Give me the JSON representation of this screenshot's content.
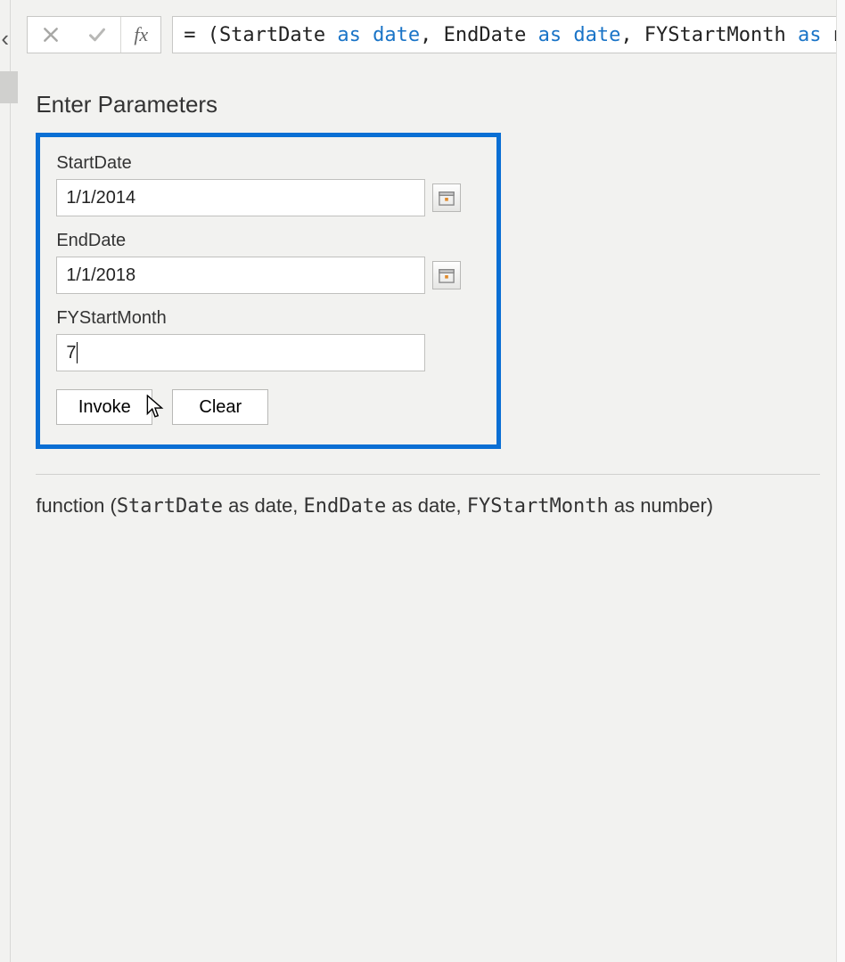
{
  "formula_bar": {
    "prefix": "= (StartDate ",
    "as1": "as",
    "sp1": " ",
    "date1": "date",
    "mid1": ", EndDate ",
    "as2": "as",
    "sp2": " ",
    "date2": "date",
    "mid2": ", FYStartMonth ",
    "as3": "as",
    "tail": " n"
  },
  "section_title": "Enter Parameters",
  "params": {
    "start_date": {
      "label": "StartDate",
      "value": "1/1/2014"
    },
    "end_date": {
      "label": "EndDate",
      "value": "1/1/2018"
    },
    "fy_month": {
      "label": "FYStartMonth",
      "value": "7"
    }
  },
  "buttons": {
    "invoke": "Invoke",
    "clear": "Clear"
  },
  "signature": {
    "pre": "function (",
    "p1": "StartDate",
    "t1": " as date, ",
    "p2": "EndDate",
    "t2": " as date, ",
    "p3": "FYStartMonth",
    "t3": " as number) "
  },
  "icons": {
    "collapse": "‹"
  }
}
